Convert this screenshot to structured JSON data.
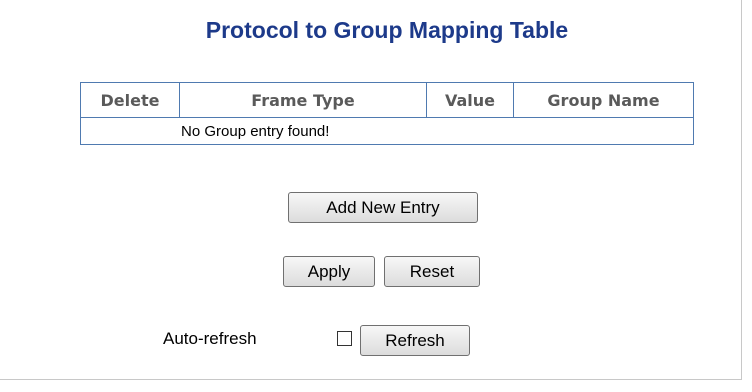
{
  "title": "Protocol to Group Mapping Table",
  "table": {
    "columns": [
      "Delete",
      "Frame Type",
      "Value",
      "Group Name"
    ],
    "empty_message": "No Group entry found!"
  },
  "buttons": {
    "add": "Add New Entry",
    "apply": "Apply",
    "reset": "Reset",
    "refresh": "Refresh"
  },
  "auto_refresh": {
    "label": "Auto-refresh",
    "checked": false
  },
  "colors": {
    "title": "#1d3a8a",
    "table_border": "#4f7ab0",
    "header_text": "#5a5a5a"
  }
}
